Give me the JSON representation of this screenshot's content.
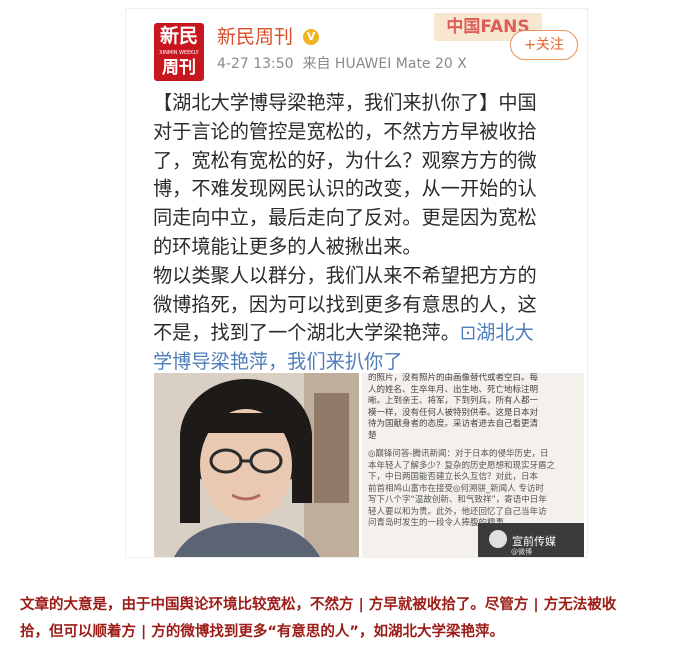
{
  "post": {
    "account": {
      "name": "新民周刊",
      "avatar_line1": "新民",
      "avatar_line2": "XINMIN WEEKLY",
      "avatar_line3": "周刊",
      "time": "4-27 13:50",
      "source": "来自 HUAWEI Mate 20 X"
    },
    "banner_text": "中国FANS",
    "follow_label": "+关注",
    "text_lines": [
      "【湖北大学博导梁艳萍，我们来扒你了】中国",
      "对于言论的管控是宽松的，不然方方早被收拾",
      "了，宽松有宽松的好，为什么？观察方方的微",
      "博，不难发现网民认识的改变，从一开始的认",
      "同走向中立，最后走向了反对。更是因为宽松",
      "的环境能让更多的人被揪出来。",
      "物以类聚人以群分，我们从来不希望把方方的",
      "微博掐死，因为可以找到更多有意思的人，这",
      "不是，找到了一个湖北大学梁艳萍。"
    ],
    "link_line1": "⊡湖北大",
    "link_line2": "学博导梁艳萍，我们来扒你了",
    "news_text_top": "的照片，没有照片的由画像替代或者空白。每\n人的姓名、生卒年月、出生地、死亡地标注明\n晰。上到亲王、将军，下到列兵，所有人都一\n模一样，没有任何人被特别供奉。这是日本对\n待为国献身者的态度。采访者进去自己看更清\n楚",
    "news_text_bottom": "◎巅锋问答-腾讯新闻：对于日本的侵华历史，日\n本年轻人了解多少？复杂的历史愿想和现实牙盾之\n下，中日两国能否建立长久互信？对此，日本\n前首相鸠山富市在接受◎何溯骈_新闻人 专访时\n写下八个字“温故创新、和气致祥”，寄语中日年\n轻人要以和为贵。此外，他还回忆了自己当年访\n问青岛时发生的一段令人捧腹的糗事。",
    "watermark": "宣前传媒",
    "watermark_small": "@微博"
  },
  "caption": "文章的大意是，由于中国舆论环境比较宽松，不然方 | 方早就被收拾了。尽管方 | 方无法被收\n拾，但可以顺着方 | 方的微博找到更多“有意思的人”，如湖北大学梁艳萍。",
  "colors": {
    "caption": "#9c1b16",
    "account_name": "#d94f2b",
    "link": "#4f7dbb",
    "avatar_bg": "#c8161e",
    "follow": "#e2652c"
  }
}
